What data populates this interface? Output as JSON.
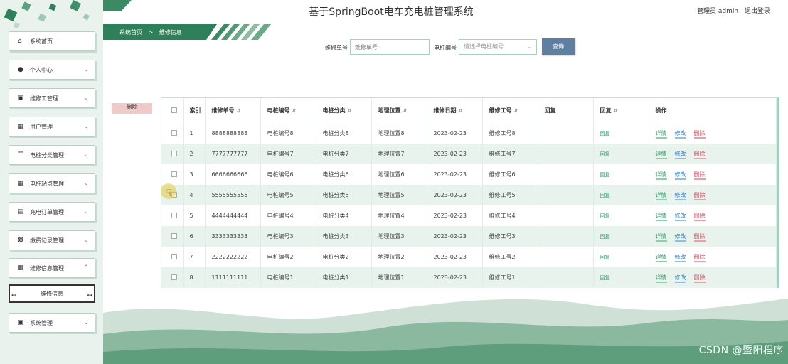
{
  "header": {
    "title": "基于SpringBoot电车充电桩管理系统",
    "user_label": "管理员 admin",
    "logout_label": "退出登录"
  },
  "breadcrumb": {
    "home": "系统首页",
    "separator": ">",
    "current": "维修信息"
  },
  "sidebar": {
    "items": [
      {
        "label": "系统首页",
        "icon": "home-icon"
      },
      {
        "label": "个人中心",
        "icon": "user-icon"
      },
      {
        "label": "维修工管理",
        "icon": "monitor-icon"
      },
      {
        "label": "用户管理",
        "icon": "grid-icon"
      },
      {
        "label": "电桩分类管理",
        "icon": "list-icon"
      },
      {
        "label": "电桩站点管理",
        "icon": "grid-icon"
      },
      {
        "label": "充电订单管理",
        "icon": "document-icon"
      },
      {
        "label": "缴费记录管理",
        "icon": "clipboard-icon"
      },
      {
        "label": "维修信息管理",
        "icon": "grid-icon"
      },
      {
        "label": "系统管理",
        "icon": "monitor-icon"
      }
    ],
    "submenu": {
      "label": "维修信息"
    }
  },
  "search": {
    "repair_no_label": "维修单号",
    "repair_no_placeholder": "维修单号",
    "pile_no_label": "电桩编号",
    "pile_no_placeholder": "请选择电桩编号",
    "query_label": "查询"
  },
  "delete_button": "删除",
  "table": {
    "headers": [
      "索引",
      "维修单号",
      "电桩编号",
      "电桩分类",
      "地理位置",
      "维修日期",
      "维修工号",
      "回复",
      "回复",
      "操作"
    ],
    "rows": [
      {
        "idx": "1",
        "repair_no": "8888888888",
        "pile_no": "电桩编号8",
        "category": "电桩分类8",
        "location": "地理位置8",
        "date": "2023-02-23",
        "worker": "维修工号8",
        "reply": "",
        "reply_link": "回复"
      },
      {
        "idx": "2",
        "repair_no": "7777777777",
        "pile_no": "电桩编号7",
        "category": "电桩分类7",
        "location": "地理位置7",
        "date": "2023-02-23",
        "worker": "维修工号7",
        "reply": "",
        "reply_link": "回复"
      },
      {
        "idx": "3",
        "repair_no": "6666666666",
        "pile_no": "电桩编号6",
        "category": "电桩分类6",
        "location": "地理位置6",
        "date": "2023-02-23",
        "worker": "维修工号6",
        "reply": "",
        "reply_link": "回复"
      },
      {
        "idx": "4",
        "repair_no": "5555555555",
        "pile_no": "电桩编号5",
        "category": "电桩分类5",
        "location": "地理位置5",
        "date": "2023-02-23",
        "worker": "维修工号5",
        "reply": "",
        "reply_link": "回复"
      },
      {
        "idx": "5",
        "repair_no": "4444444444",
        "pile_no": "电桩编号4",
        "category": "电桩分类4",
        "location": "地理位置4",
        "date": "2023-02-23",
        "worker": "维修工号4",
        "reply": "",
        "reply_link": "回复"
      },
      {
        "idx": "6",
        "repair_no": "3333333333",
        "pile_no": "电桩编号3",
        "category": "电桩分类3",
        "location": "地理位置3",
        "date": "2023-02-23",
        "worker": "维修工号3",
        "reply": "",
        "reply_link": "回复"
      },
      {
        "idx": "7",
        "repair_no": "2222222222",
        "pile_no": "电桩编号2",
        "category": "电桩分类2",
        "location": "地理位置2",
        "date": "2023-02-23",
        "worker": "维修工号2",
        "reply": "",
        "reply_link": "回复"
      },
      {
        "idx": "8",
        "repair_no": "1111111111",
        "pile_no": "电桩编号1",
        "category": "电桩分类1",
        "location": "地理位置1",
        "date": "2023-02-23",
        "worker": "维修工号1",
        "reply": "",
        "reply_link": "回复"
      }
    ],
    "actions": {
      "detail": "详情",
      "edit": "修改",
      "delete": "删除"
    }
  },
  "watermark": "CSDN @暨阳程序",
  "colors": {
    "accent_green": "#2e9e6a",
    "query_button": "#5f7fa0",
    "delete_button_bg": "#f0c9c9",
    "sidebar_bg": "#e9f2ed"
  }
}
